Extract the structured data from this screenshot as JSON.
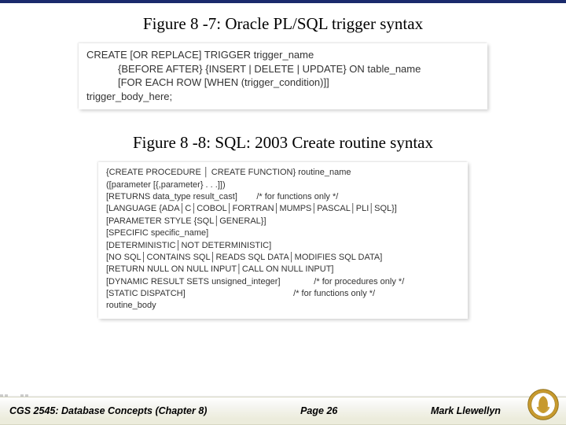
{
  "fig1": {
    "caption": "Figure 8 -7:  Oracle PL/SQL trigger syntax",
    "lines": [
      "CREATE [OR REPLACE] TRIGGER trigger_name",
      "{BEFORE AFTER} {INSERT | DELETE | UPDATE} ON table_name",
      "[FOR EACH ROW [WHEN (trigger_condition)]]",
      "trigger_body_here;"
    ]
  },
  "fig2": {
    "caption": "Figure 8 -8: SQL: 2003 Create routine syntax",
    "lines": [
      "{CREATE PROCEDURE │ CREATE FUNCTION} routine_name",
      "([parameter [{,parameter} . . .]])",
      "[RETURNS data_type result_cast]        /* for functions only */",
      "[LANGUAGE {ADA│C│COBOL│FORTRAN│MUMPS│PASCAL│PLI│SQL}]",
      "[PARAMETER STYLE {SQL│GENERAL}]",
      "[SPECIFIC specific_name]",
      "[DETERMINISTIC│NOT DETERMINISTIC]",
      "[NO SQL│CONTAINS SQL│READS SQL DATA│MODIFIES SQL DATA]",
      "[RETURN NULL ON NULL INPUT│CALL ON NULL INPUT]",
      "[DYNAMIC RESULT SETS unsigned_integer]              /* for procedures only */",
      "[STATIC DISPATCH]                                             /* for functions only */",
      "routine_body"
    ]
  },
  "footer": {
    "left": "CGS 2545: Database Concepts  (Chapter 8)",
    "center": "Page 26",
    "right": "Mark Llewellyn"
  }
}
